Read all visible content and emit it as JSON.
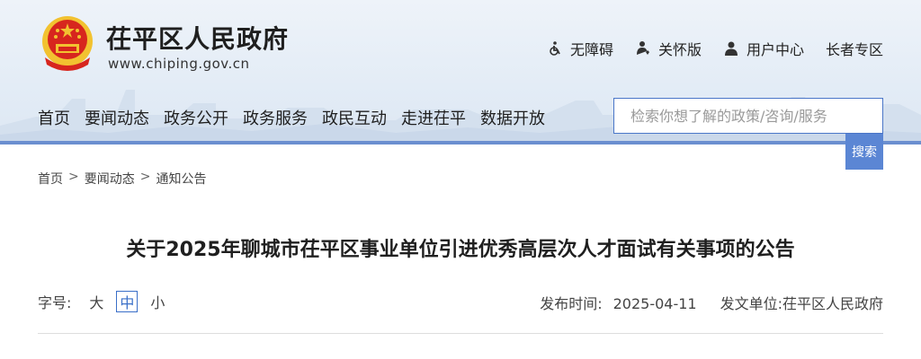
{
  "site": {
    "title": "茌平区人民政府",
    "url": "www.chiping.gov.cn"
  },
  "toplinks": [
    {
      "label": "无障碍",
      "icon": "wheelchair-icon"
    },
    {
      "label": "关怀版",
      "icon": "care-icon"
    },
    {
      "label": "用户中心",
      "icon": "user-icon"
    },
    {
      "label": "长者专区",
      "icon": ""
    }
  ],
  "nav": [
    "首页",
    "要闻动态",
    "政务公开",
    "政务服务",
    "政民互动",
    "走进茌平",
    "数据开放"
  ],
  "search": {
    "placeholder": "检索你想了解的政策/咨询/服务",
    "button_label": "搜索"
  },
  "breadcrumb": [
    "首页",
    "要闻动态",
    "通知公告"
  ],
  "breadcrumb_sep": ">",
  "article": {
    "title": "关于2025年聊城市茌平区事业单位引进优秀高层次人才面试有关事项的公告"
  },
  "meta": {
    "font_size_label": "字号:",
    "font_sizes": [
      "大",
      "中",
      "小"
    ],
    "font_size_selected": "中",
    "publish_label": "发布时间:",
    "publish_date": "2025-04-11",
    "issuer_label": "发文单位:",
    "issuer": "茌平区人民政府"
  },
  "colors": {
    "accent": "#5b86d4",
    "header_line": "#6b8fd0",
    "emblem_red": "#d7261e",
    "emblem_gold": "#f2c230"
  }
}
